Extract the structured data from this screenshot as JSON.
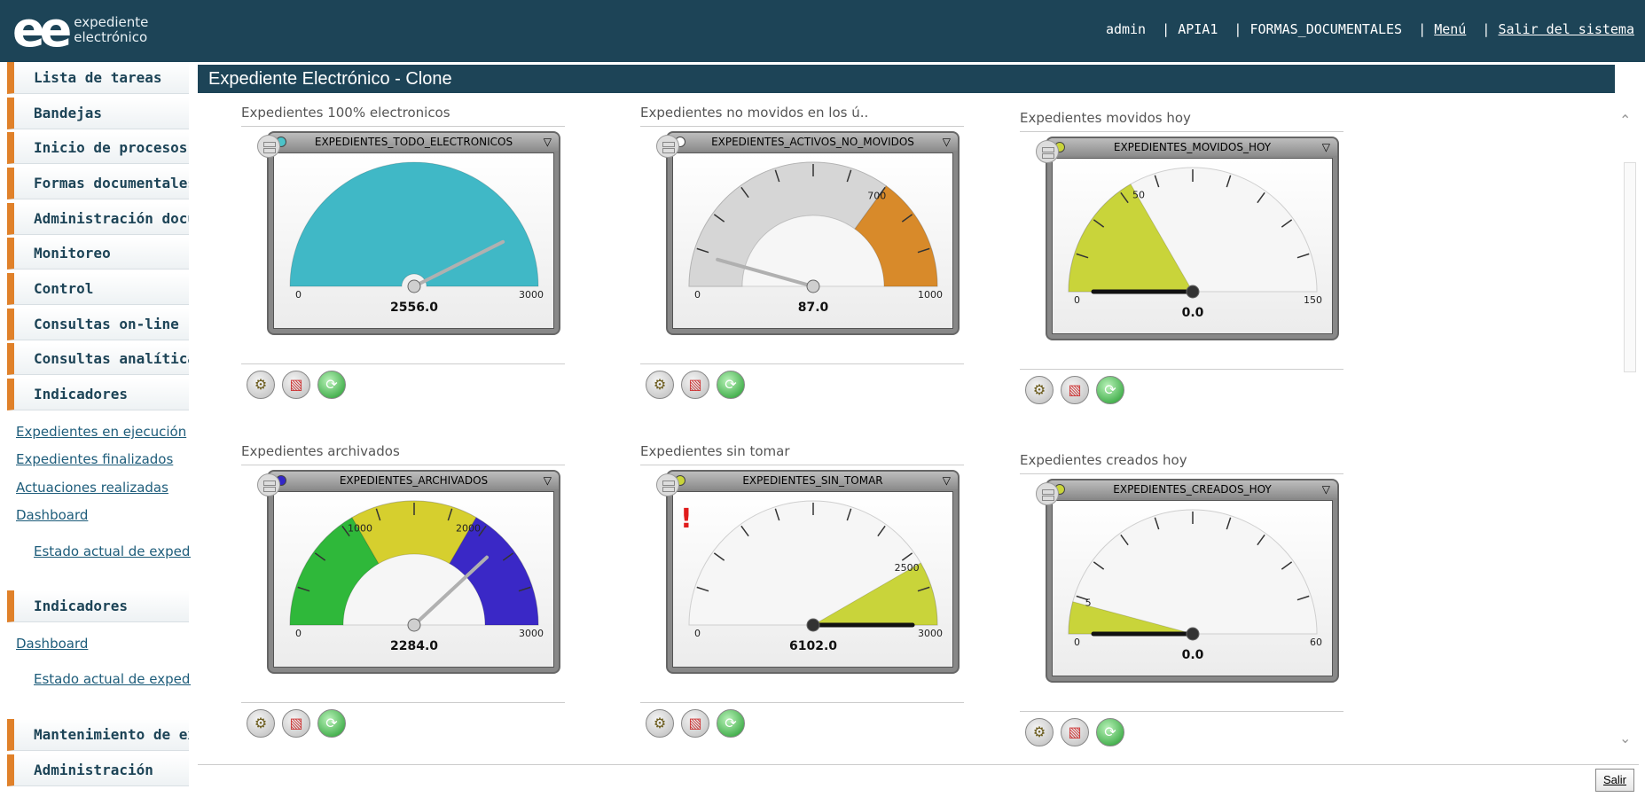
{
  "brand": {
    "mark": "ee",
    "line1": "expediente",
    "line2": "electrónico"
  },
  "top_links": {
    "user": "admin",
    "env": "APIA1",
    "module": "FORMAS_DOCUMENTALES",
    "menu": "Menú",
    "logout": "Salir del sistema"
  },
  "sidebar": {
    "items": [
      {
        "label": "Lista de tareas"
      },
      {
        "label": "Bandejas"
      },
      {
        "label": "Inicio de procesos"
      },
      {
        "label": "Formas documentales"
      },
      {
        "label": "Administración documental"
      },
      {
        "label": "Monitoreo"
      },
      {
        "label": "Control"
      },
      {
        "label": "Consultas on-line"
      },
      {
        "label": "Consultas analíticas"
      },
      {
        "label": "Indicadores"
      }
    ],
    "links": [
      {
        "label": "Expedientes en ejecución"
      },
      {
        "label": "Expedientes finalizados"
      },
      {
        "label": "Actuaciones realizadas"
      },
      {
        "label": "Dashboard"
      }
    ],
    "sub1": "Estado actual de expedientes",
    "section2": "Indicadores",
    "link2": "Dashboard",
    "sub2": "Estado actual de expedientes",
    "bottom_items": [
      {
        "label": "Mantenimiento de expedientes"
      },
      {
        "label": "Administración"
      }
    ]
  },
  "main": {
    "title": "Expediente Electrónico - Clone",
    "salir": "Salir"
  },
  "widgets": [
    {
      "title": "Expedientes 100% electronicos",
      "header": "EXPEDIENTES_TODO_ELECTRONICOS",
      "dot": "#4bc3c9",
      "min": "0",
      "max": "3000",
      "value": 2556,
      "value_label": "2556.0",
      "ticks": [],
      "bands": [
        {
          "from": 0,
          "to": 3000,
          "color": "#40b8c6"
        }
      ],
      "style": "solid",
      "warn": false
    },
    {
      "title": "Expedientes no movidos en los ú..",
      "header": "EXPEDIENTES_ACTIVOS_NO_MOVIDOS",
      "dot": "#ffffff",
      "min": "0",
      "max": "1000",
      "value": 87,
      "value_label": "87.0",
      "ticks": [
        {
          "v": 700,
          "label": "700"
        }
      ],
      "bands": [
        {
          "from": 0,
          "to": 700,
          "color": "#d6d6d6"
        },
        {
          "from": 700,
          "to": 1000,
          "color": "#d88a2a"
        }
      ],
      "style": "ring",
      "warn": false
    },
    {
      "title": "Expedientes movidos hoy",
      "header": "EXPEDIENTES_MOVIDOS_HOY",
      "dot": "#c9d43a",
      "min": "0",
      "max": "150",
      "value": 0,
      "value_label": "0.0",
      "ticks": [
        {
          "v": 50,
          "label": "50"
        }
      ],
      "bands": [
        {
          "from": 0,
          "to": 50,
          "color": "#c9d43a"
        }
      ],
      "style": "sector",
      "warn": false
    },
    {
      "title": "Expedientes archivados",
      "header": "EXPEDIENTES_ARCHIVADOS",
      "dot": "#3326c8",
      "min": "0",
      "max": "3000",
      "value": 2284,
      "value_label": "2284.0",
      "ticks": [
        {
          "v": 1000,
          "label": "1000"
        },
        {
          "v": 2000,
          "label": "2000"
        }
      ],
      "bands": [
        {
          "from": 0,
          "to": 1000,
          "color": "#2fb83a"
        },
        {
          "from": 1000,
          "to": 2000,
          "color": "#d6cf2e"
        },
        {
          "from": 2000,
          "to": 3000,
          "color": "#3a28c6"
        }
      ],
      "style": "ring",
      "warn": false
    },
    {
      "title": "Expedientes sin tomar",
      "header": "EXPEDIENTES_SIN_TOMAR",
      "dot": "#c9d43a",
      "min": "0",
      "max": "3000",
      "value": 6102,
      "value_label": "6102.0",
      "ticks": [
        {
          "v": 2500,
          "label": "2500"
        }
      ],
      "bands": [
        {
          "from": 2500,
          "to": 3000,
          "color": "#c9d43a"
        }
      ],
      "style": "sector",
      "warn": true,
      "warn_mark": "!"
    },
    {
      "title": "Expedientes creados hoy",
      "header": "EXPEDIENTES_CREADOS_HOY",
      "dot": "#c9d43a",
      "min": "0",
      "max": "60",
      "value": 0,
      "value_label": "0.0",
      "ticks": [
        {
          "v": 5,
          "label": "5"
        }
      ],
      "bands": [
        {
          "from": 0,
          "to": 5,
          "color": "#c9d43a"
        }
      ],
      "style": "sector",
      "warn": false
    }
  ],
  "colors": {
    "header_bg": "#1d4457",
    "accent": "#e0812a"
  },
  "icons": {
    "tools": "tools-icon",
    "report": "report-icon",
    "refresh": "refresh-icon"
  }
}
